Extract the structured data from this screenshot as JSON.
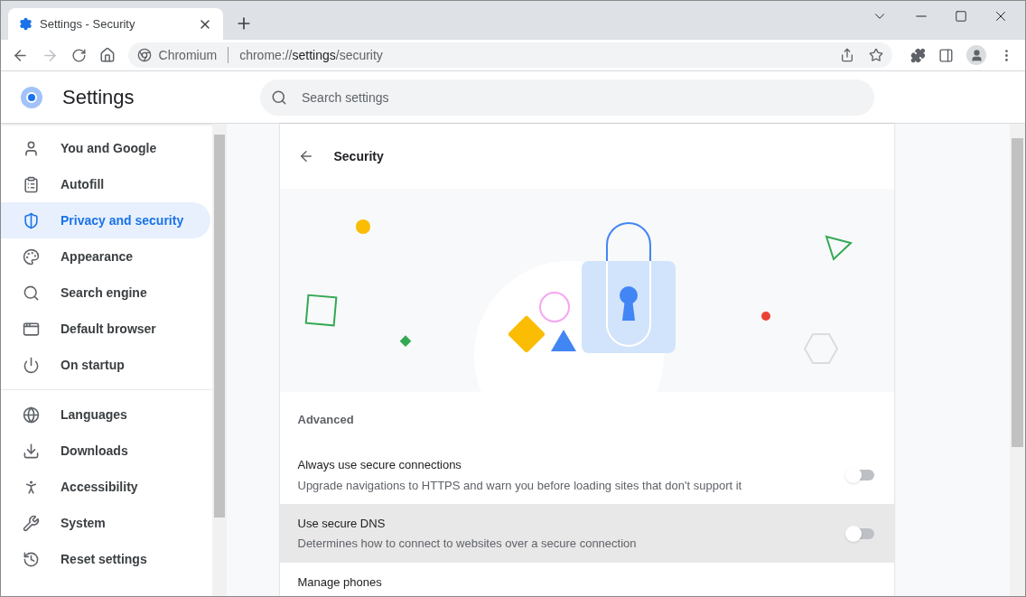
{
  "tab": {
    "title": "Settings - Security",
    "selected": true
  },
  "address_bar": {
    "site": "Chromium",
    "scheme": "chrome://",
    "host": "settings",
    "path": "/security"
  },
  "header": {
    "title": "Settings",
    "search": {
      "placeholder": "Search settings"
    }
  },
  "sidebar": {
    "groups": [
      [
        {
          "label": "You and Google",
          "selected": false
        },
        {
          "label": "Autofill",
          "selected": false
        },
        {
          "label": "Privacy and security",
          "selected": true
        },
        {
          "label": "Appearance",
          "selected": false
        },
        {
          "label": "Search engine",
          "selected": false
        },
        {
          "label": "Default browser",
          "selected": false
        },
        {
          "label": "On startup",
          "selected": false
        }
      ],
      [
        {
          "label": "Languages",
          "selected": false
        },
        {
          "label": "Downloads",
          "selected": false
        },
        {
          "label": "Accessibility",
          "selected": false
        },
        {
          "label": "System",
          "selected": false
        },
        {
          "label": "Reset settings",
          "selected": false
        }
      ]
    ]
  },
  "page": {
    "title": "Security",
    "section": "Advanced",
    "rows": [
      {
        "kind": "toggle",
        "title": "Always use secure connections",
        "subtitle": "Upgrade navigations to HTTPS and warn you before loading sites that don't support it",
        "on": false,
        "hovered": false
      },
      {
        "kind": "toggle",
        "title": "Use secure DNS",
        "subtitle": "Determines how to connect to websites over a secure connection",
        "on": false,
        "hovered": true
      },
      {
        "kind": "link",
        "title": "Manage phones",
        "hovered": false
      }
    ]
  }
}
